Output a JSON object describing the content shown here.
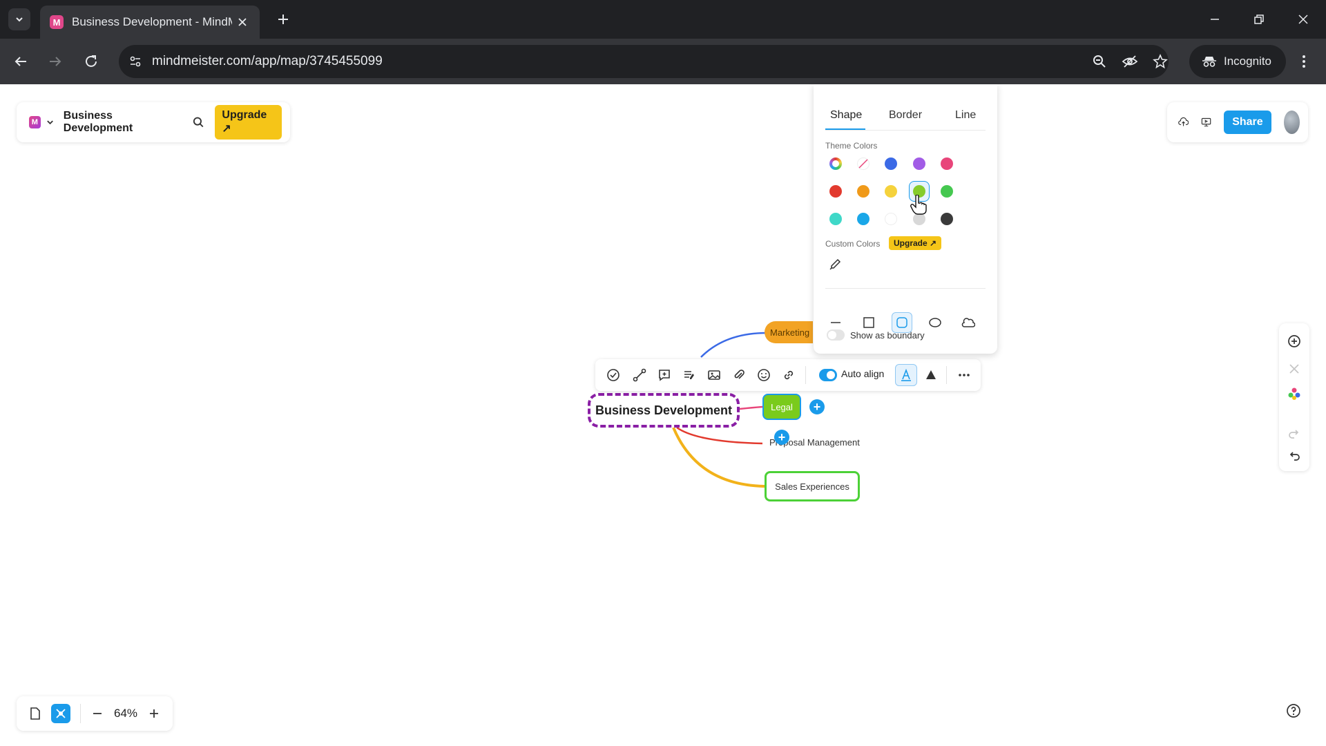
{
  "browser": {
    "tab_title": "Business Development - MindM",
    "tab_favicon": "M",
    "url": "mindmeister.com/app/map/3745455099",
    "incognito_label": "Incognito"
  },
  "app": {
    "map_title": "Business Development",
    "upgrade_label": "Upgrade ↗",
    "share_label": "Share",
    "zoom": "64%"
  },
  "node_toolbar": {
    "auto_align_label": "Auto align"
  },
  "style_panel": {
    "tabs": [
      "Shape",
      "Border",
      "Line"
    ],
    "active_tab": "Shape",
    "theme_colors_label": "Theme Colors",
    "custom_colors_label": "Custom Colors",
    "upgrade_label": "Upgrade ↗",
    "show_boundary_label": "Show as boundary",
    "theme_colors": [
      "rainbow",
      "none",
      "#3b6ae6",
      "#a25ce6",
      "#e8457a",
      "#e23a2e",
      "#f09a1a",
      "#f5d23c",
      "#86cc2a",
      "#45c850",
      "#3fd8c8",
      "#1aa7e8",
      "#ffffff",
      "#d8d8d8",
      "#3a3a3a"
    ],
    "selected_color": "#86cc2a",
    "shapes": [
      "line-shape",
      "rectangle-shape",
      "rounded-rectangle-shape",
      "ellipse-shape",
      "cloud-shape"
    ],
    "selected_shape": "rounded-rectangle-shape"
  },
  "mindmap": {
    "root": "Business Development",
    "children": [
      "Marketing",
      "Legal",
      "Proposal Management",
      "Sales Experiences"
    ],
    "colors": {
      "root_border": "#8a1fa5",
      "marketing": "#f2a324",
      "legal": "#7acb1c",
      "sales_border": "#4cd137",
      "accent": "#1a9bea"
    }
  }
}
